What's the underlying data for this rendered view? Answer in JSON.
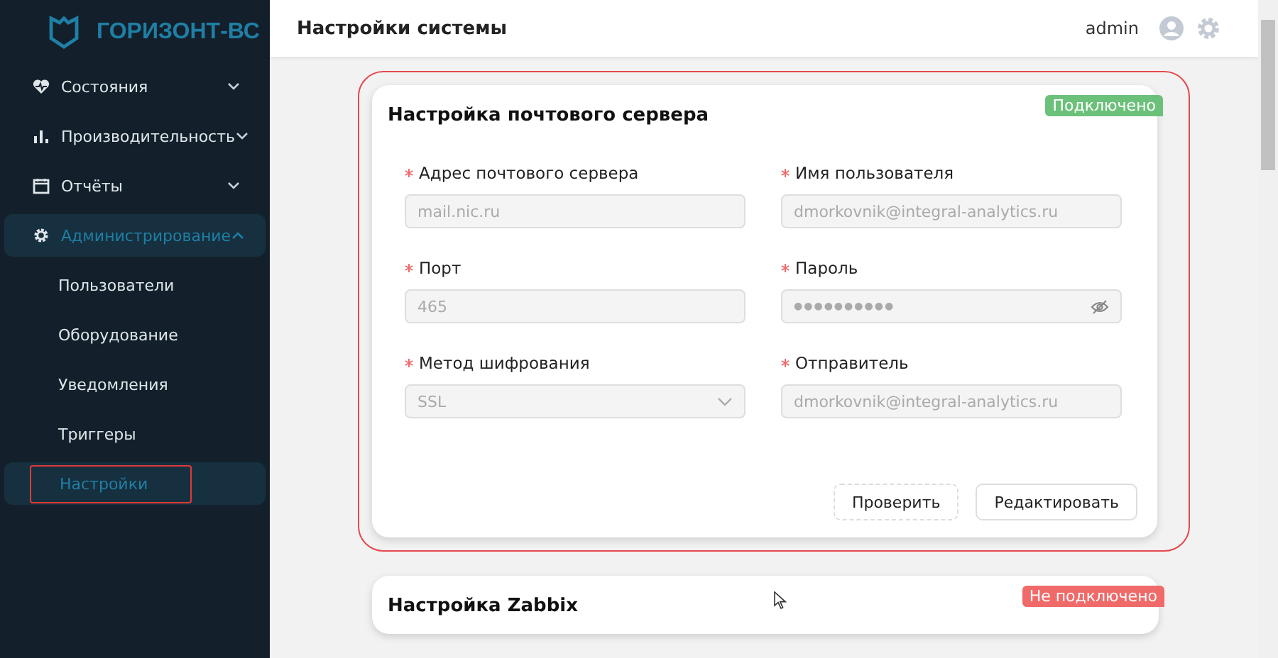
{
  "sidebar": {
    "logo": "ГОРИЗОНТ-ВС",
    "items": [
      {
        "label": "Состояния",
        "expanded": false,
        "selected": false
      },
      {
        "label": "Производительность",
        "expanded": false,
        "selected": false
      },
      {
        "label": "Отчёты",
        "expanded": false,
        "selected": false
      },
      {
        "label": "Администрирование",
        "expanded": true,
        "selected": true,
        "children": [
          {
            "label": "Пользователи",
            "selected": false
          },
          {
            "label": "Оборудование",
            "selected": false
          },
          {
            "label": "Уведомления",
            "selected": false
          },
          {
            "label": "Триггеры",
            "selected": false
          },
          {
            "label": "Настройки",
            "selected": true
          }
        ]
      }
    ]
  },
  "header": {
    "title": "Настройки системы",
    "user": "admin"
  },
  "cards": [
    {
      "title": "Настройка почтового сервера",
      "status": "Подключено",
      "color": "#6cc17a",
      "highlighted": true,
      "fields": [
        {
          "kind": "text",
          "label": "Адрес почтового сервера",
          "required": true,
          "value": "mail.nic.ru"
        },
        {
          "kind": "text",
          "label": "Имя пользователя",
          "required": true,
          "value": "dmorkovnik@integral-analytics.ru"
        },
        {
          "kind": "text",
          "label": "Порт",
          "required": true,
          "value": "465"
        },
        {
          "kind": "password",
          "label": "Пароль",
          "required": true,
          "value": "●●●●●●●●●●"
        },
        {
          "kind": "select",
          "label": "Метод шифрования",
          "required": true,
          "value": "SSL"
        },
        {
          "kind": "text",
          "label": "Отправитель",
          "required": true,
          "value": "dmorkovnik@integral-analytics.ru"
        }
      ],
      "buttons": [
        {
          "label": "Проверить",
          "kind": "dashed"
        },
        {
          "label": "Редактировать",
          "kind": "solid"
        }
      ]
    },
    {
      "title": "Настройка Zabbix",
      "status": "Не подключено",
      "color": "#f06a6a",
      "highlighted": false
    }
  ]
}
